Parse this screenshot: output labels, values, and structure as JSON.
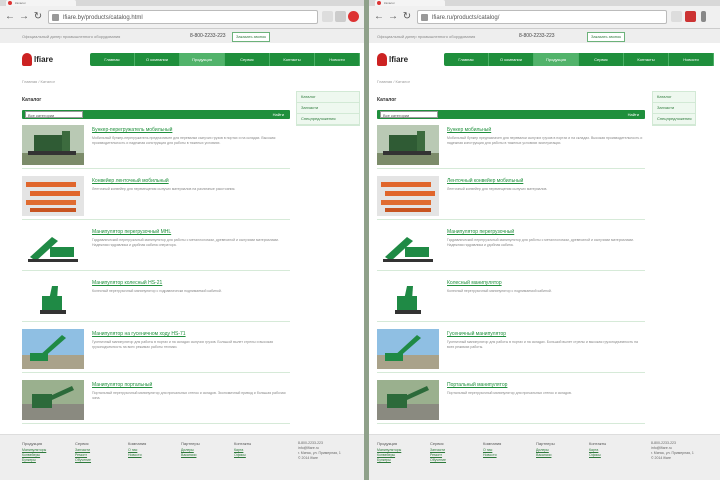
{
  "browser": {
    "tab_title": "Каталог",
    "left_url": "lfiare.by/products/catalog.html",
    "right_url": "lfiare.ru/products/catalog/"
  },
  "site": {
    "logo_text": "lfiare",
    "top_left_text": "Официальный дилер промышленного оборудования",
    "phone": "8-800-2233-223",
    "callback": "Заказать звонок"
  },
  "nav": {
    "items": [
      "Главная",
      "О компании",
      "Продукция",
      "Сервис",
      "Контакты",
      "Новости"
    ],
    "active_index": 2
  },
  "breadcrumb": "Главная / Каталог",
  "page_title": "Каталог",
  "filter": {
    "select_value": "Все категории",
    "button_label": "Найти"
  },
  "sidebar": {
    "items": [
      "Каталог",
      "Запчасти",
      "Спецпредложения"
    ]
  },
  "left_items": [
    {
      "title": "Бункер-перегружатель мобильный",
      "desc": "Мобильный бункер-перегружатель предназначен для перевалки сыпучих грузов в портах и на складах. Высокая производительность и надежная конструкция для работы в тяжелых условиях."
    },
    {
      "title": "Конвейер ленточный мобильный",
      "desc": "Ленточный конвейер для перемещения сыпучих материалов на различные расстояния."
    },
    {
      "title": "Манипулятор перегрузочный MHL",
      "desc": "Гидравлический перегрузочный манипулятор для работы с металлоломом, древесиной и сыпучими материалами. Надежная гидравлика и удобная кабина оператора."
    },
    {
      "title": "Манипулятор колесный HS-21",
      "desc": "Колесный перегрузочный манипулятор с гидравлически поднимаемой кабиной."
    },
    {
      "title": "Манипулятор на гусеничном ходу HS-71",
      "desc": "Гусеничный манипулятор для работы в портах и на складах сыпучих грузов. Большой вылет стрелы и высокая грузоподъемность на всех режимах работы техники."
    },
    {
      "title": "Манипулятор портальный",
      "desc": "Портальный перегрузочный манипулятор для причальных стенок и складов. Экономичный привод и большая рабочая зона."
    }
  ],
  "right_items": [
    {
      "title": "Бункер мобильный",
      "desc": "Мобильный бункер предназначен для перевалки сыпучих грузов в портах и на складах. Высокая производительность и надежная конструкция для работы в тяжелых условиях эксплуатации."
    },
    {
      "title": "Ленточный конвейер мобильный",
      "desc": "Ленточный конвейер для перемещения сыпучих материалов."
    },
    {
      "title": "Манипулятор перегрузочный",
      "desc": "Гидравлический перегрузочный манипулятор для работы с металлоломом, древесиной и сыпучими материалами. Надежная гидравлика и удобная кабина."
    },
    {
      "title": "Колесный манипулятор",
      "desc": "Колесный перегрузочный манипулятор с поднимаемой кабиной."
    },
    {
      "title": "Гусеничный манипулятор",
      "desc": "Гусеничный манипулятор для работы в портах и на складах. Большой вылет стрелы и высокая грузоподъемность на всех режимах работы."
    },
    {
      "title": "Портальный манипулятор",
      "desc": "Портальный перегрузочный манипулятор для причальных стенок и складов."
    }
  ],
  "footer": {
    "columns": [
      {
        "heading": "Продукция",
        "links": [
          "Манипуляторы",
          "Конвейеры",
          "Бункеры"
        ]
      },
      {
        "heading": "Сервис",
        "links": [
          "Запчасти",
          "Ремонт",
          "Обучение"
        ]
      },
      {
        "heading": "Компания",
        "links": [
          "О нас",
          "Новости"
        ]
      },
      {
        "heading": "Партнеры",
        "links": [
          "Дилеры",
          "Вакансии"
        ]
      },
      {
        "heading": "Контакты",
        "links": [
          "Карта",
          "Офисы"
        ]
      }
    ],
    "contact_lines": [
      "8-800-2233-223",
      "info@lfiare.ru",
      "г. Минск, ул. Примерная, 1"
    ],
    "copyright": "© 2014 lfiare"
  },
  "colors": {
    "brand_green": "#1f8f3c",
    "accent_red": "#cc2222"
  },
  "icons": [
    "back-icon",
    "forward-icon",
    "reload-icon",
    "lock-icon",
    "star-icon",
    "menu-icon",
    "close-icon"
  ]
}
